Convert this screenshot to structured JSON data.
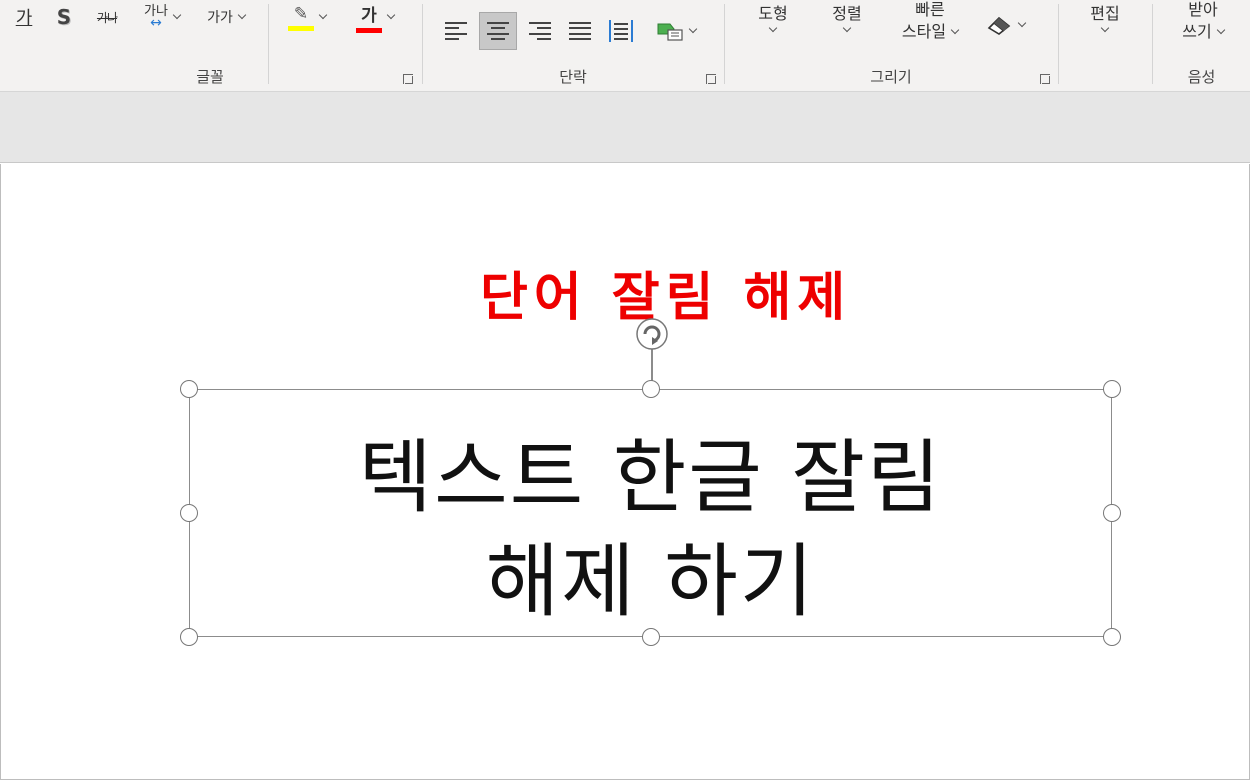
{
  "ribbon": {
    "font_group": {
      "label": "글꼴",
      "underline_btn": "가",
      "shadow_btn": "S",
      "strike_btn": "가나",
      "spacing_btn_top": "가나",
      "spacing_btn_arrow": "↔",
      "case_btn": "가가",
      "highlight_btn_glyph": "✎",
      "highlight_color": "#ffff00",
      "font_color_btn": "가",
      "font_color": "#ff0000"
    },
    "paragraph_group": {
      "label": "단락",
      "smartart_icon": "smartart-icon"
    },
    "drawing_group": {
      "label": "그리기",
      "shapes_label": "도형",
      "arrange_label": "정렬",
      "quick_styles_line1": "빠른",
      "quick_styles_line2": "스타일",
      "eraser_icon": "eraser-icon"
    },
    "editing_group": {
      "label_partial": "편집"
    },
    "voice_group": {
      "label": "음성",
      "dictate_line1": "받아",
      "dictate_line2": "쓰기"
    }
  },
  "slide": {
    "annotation_text": "단어 잘림 해제",
    "annotation_color": "#ee0000",
    "textbox_line1": "텍스트 한글 잘림",
    "textbox_line2": "해제 하기"
  }
}
